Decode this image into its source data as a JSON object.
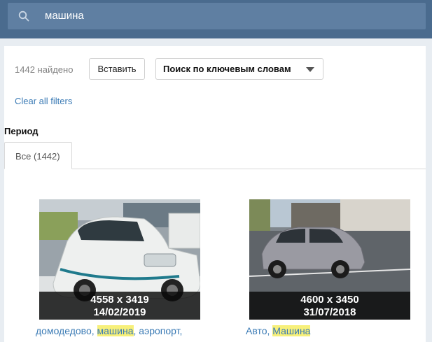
{
  "search": {
    "query": "машина",
    "icon": "search-icon"
  },
  "toolbar": {
    "found_text": "1442 найдено",
    "insert_label": "Вставить",
    "mode_selected": "Поиск по ключевым словам",
    "clear_filters": "Clear all filters"
  },
  "period": {
    "label": "Период",
    "tabs": [
      {
        "label": "Все (1442)"
      }
    ]
  },
  "results": [
    {
      "dims": "4558 x 3419",
      "date": "14/02/2019",
      "tags": [
        "домодедово",
        "машина",
        "аэропорт"
      ],
      "highlight_index": 1
    },
    {
      "dims": "4600 x 3450",
      "date": "31/07/2018",
      "tags": [
        "Авто",
        "Машина"
      ],
      "highlight_index": 1
    }
  ],
  "colors": {
    "topbar": "#4a6b8e",
    "searchbox": "#5f7fa2",
    "link": "#3b7bb5",
    "highlight": "#f7f07a"
  }
}
